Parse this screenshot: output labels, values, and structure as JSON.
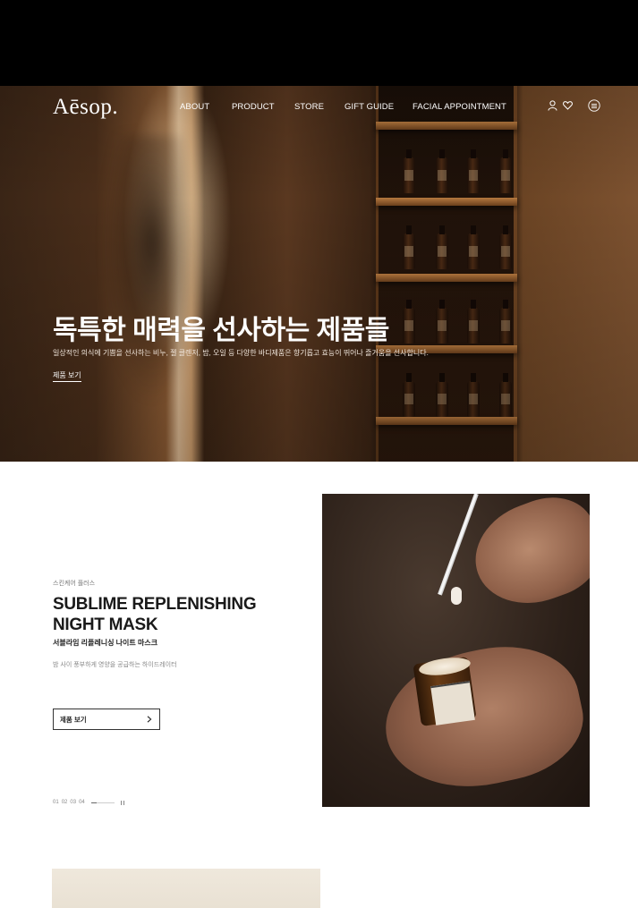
{
  "header": {
    "logo": "Aēsop.",
    "nav": [
      {
        "label": "ABOUT"
      },
      {
        "label": "PRODUCT"
      },
      {
        "label": "STORE"
      },
      {
        "label": "GIFT GUIDE"
      },
      {
        "label": "FACIAL APPOINTMENT"
      }
    ],
    "icons": [
      "user-icon",
      "heart-icon",
      "menu-icon"
    ]
  },
  "hero": {
    "title": "독특한 매력을 선사하는 제품들",
    "description": "일상적인 의식에 기쁨을 선사하는 비누, 젤 클렌저, 밤, 오일 등 다양한 바디제품은 향기롭고 효능이 뛰어나 즐거움을 선사합니다.",
    "link_label": "제품 보기"
  },
  "featured": {
    "eyebrow": "스킨케어 플러스",
    "title_line1": "SUBLIME REPLENISHING",
    "title_line2": "NIGHT MASK",
    "subtitle": "서블라임 리플레니싱 나이트 마스크",
    "description": "밤 사이 풍부하게 영양을 공급하는 하이드레이터",
    "button_label": "제품 보기",
    "pager": {
      "pages": [
        "01",
        "02",
        "03",
        "04"
      ],
      "current": 1,
      "progress": 0.25
    }
  },
  "colors": {
    "topbar": "#000000",
    "text_dark": "#1a1a1a",
    "bottom_card": "#ece4d7"
  }
}
